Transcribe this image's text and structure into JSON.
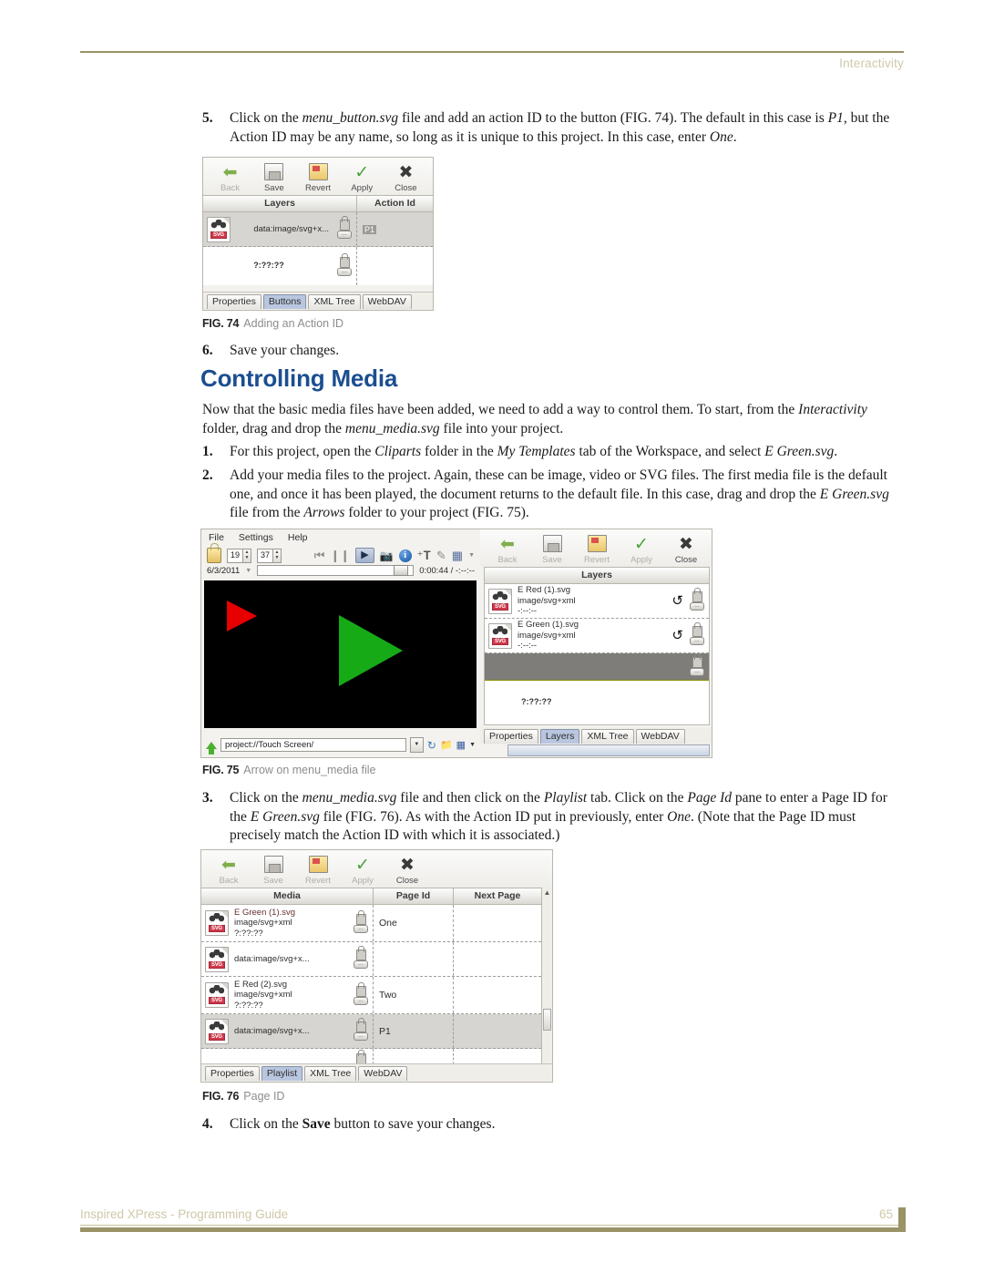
{
  "page": {
    "header_label": "Interactivity",
    "footer_title": "Inspired XPress - Programming Guide",
    "footer_page_number": "65",
    "accent_rule_color": "#9a9367",
    "heading_color": "#1b4e90"
  },
  "content": {
    "section_heading": "Controlling Media",
    "step5": {
      "number": "5.",
      "parts": [
        {
          "t": "Click on the ",
          "s": "n"
        },
        {
          "t": "menu_button.svg",
          "s": "i"
        },
        {
          "t": " file and add an action ID to the button (FIG. 74). The default in this case is ",
          "s": "n"
        },
        {
          "t": "P1",
          "s": "i"
        },
        {
          "t": ", but the Action ID may be any name, so long as it is unique to this project. In this case, enter ",
          "s": "n"
        },
        {
          "t": "One",
          "s": "i"
        },
        {
          "t": ".",
          "s": "n"
        }
      ]
    },
    "step6": {
      "number": "6.",
      "text": "Save your changes."
    },
    "intro_paragraph": [
      {
        "t": "Now that the basic media files have been added, we need to add a way to control them. To start, from the ",
        "s": "n"
      },
      {
        "t": "Interactivity",
        "s": "i"
      },
      {
        "t": " folder, drag and drop the ",
        "s": "n"
      },
      {
        "t": "menu_media.svg",
        "s": "i"
      },
      {
        "t": " file into your project.",
        "s": "n"
      }
    ],
    "step1": {
      "number": "1.",
      "parts": [
        {
          "t": "For this project, open the ",
          "s": "n"
        },
        {
          "t": "Cliparts",
          "s": "i"
        },
        {
          "t": " folder in the ",
          "s": "n"
        },
        {
          "t": "My Templates",
          "s": "i"
        },
        {
          "t": " tab of the Workspace, and select ",
          "s": "n"
        },
        {
          "t": "E Green.svg",
          "s": "i"
        },
        {
          "t": ".",
          "s": "n"
        }
      ]
    },
    "step2": {
      "number": "2.",
      "parts": [
        {
          "t": "Add your media files to the project. Again, these can be image, video or SVG files. The first media file is the default one, and once it has been played, the document returns to the default file. In this case, drag and drop the ",
          "s": "n"
        },
        {
          "t": "E Green.svg",
          "s": "i"
        },
        {
          "t": " file from the ",
          "s": "n"
        },
        {
          "t": "Arrows",
          "s": "i"
        },
        {
          "t": " folder to your project (FIG. 75).",
          "s": "n"
        }
      ]
    },
    "step3": {
      "number": "3.",
      "parts": [
        {
          "t": "Click on the ",
          "s": "n"
        },
        {
          "t": "menu_media.svg",
          "s": "i"
        },
        {
          "t": " file and then click on the ",
          "s": "n"
        },
        {
          "t": "Playlist",
          "s": "i"
        },
        {
          "t": " tab. Click on the ",
          "s": "n"
        },
        {
          "t": "Page Id",
          "s": "i"
        },
        {
          "t": " pane to enter a Page ID for the ",
          "s": "n"
        },
        {
          "t": "E Green.svg",
          "s": "i"
        },
        {
          "t": " file (FIG. 76). As with the Action ID put in previously, enter ",
          "s": "n"
        },
        {
          "t": "One",
          "s": "i"
        },
        {
          "t": ". (Note that the Page ID must precisely match the Action ID with which it is associated.)",
          "s": "n"
        }
      ]
    },
    "step4": {
      "number": "4.",
      "parts": [
        {
          "t": "Click on the ",
          "s": "n"
        },
        {
          "t": "Save",
          "s": "b"
        },
        {
          "t": " button to save your changes.",
          "s": "n"
        }
      ]
    }
  },
  "figures": {
    "fig74": {
      "caption_label": "FIG. 74",
      "caption_text": "Adding an Action ID",
      "toolbar": [
        {
          "label": "Back",
          "icon": "back-arrow-icon",
          "enabled": false
        },
        {
          "label": "Save",
          "icon": "save-disk-icon",
          "enabled": true
        },
        {
          "label": "Revert",
          "icon": "revert-icon",
          "enabled": true
        },
        {
          "label": "Apply",
          "icon": "checkmark-icon",
          "enabled": true
        },
        {
          "label": "Close",
          "icon": "close-x-icon",
          "enabled": true
        }
      ],
      "columns": [
        "Layers",
        "Action Id"
      ],
      "rows": [
        {
          "media": "data:image/svg+x...",
          "action_id": "P1",
          "selected": true
        },
        {
          "media": "",
          "action_id": "",
          "selected": false
        }
      ],
      "duration_text": "?:??:??",
      "tabs": [
        {
          "label": "Properties",
          "active": false
        },
        {
          "label": "Buttons",
          "active": true
        },
        {
          "label": "XML Tree",
          "active": false
        },
        {
          "label": "WebDAV",
          "active": false
        }
      ]
    },
    "fig75": {
      "caption_label": "FIG. 75",
      "caption_text": "Arrow on menu_media file",
      "menus": [
        "File",
        "Settings",
        "Help"
      ],
      "spinner_1": "19",
      "spinner_2": "37",
      "date_value": "6/3/2011",
      "time_readout": "0:00:44 / -:--:--",
      "transport_icons": [
        "skip-previous-icon",
        "pause-icon",
        "play-icon",
        "camera-icon",
        "info-icon",
        "add-text-icon",
        "edit-icon",
        "grid-icon",
        "chevron-down-icon"
      ],
      "path_value": "project://Touch Screen/",
      "path_icons": [
        "up-arrow-icon",
        "refresh-icon",
        "new-folder-icon",
        "view-grid-icon",
        "chevron-down-icon"
      ],
      "panel_toolbar": [
        {
          "label": "Back",
          "icon": "back-arrow-icon",
          "enabled": true
        },
        {
          "label": "Save",
          "icon": "save-disk-icon",
          "enabled": false
        },
        {
          "label": "Revert",
          "icon": "revert-icon",
          "enabled": false
        },
        {
          "label": "Apply",
          "icon": "checkmark-icon",
          "enabled": false
        },
        {
          "label": "Close",
          "icon": "close-x-icon",
          "enabled": true
        }
      ],
      "columns": [
        "Layers"
      ],
      "rows": [
        {
          "name": "E Red (1).svg",
          "mime": "image/svg+xml",
          "duration": "-:--:--",
          "loop": true
        },
        {
          "name": "E Green (1).svg",
          "mime": "image/svg+xml",
          "duration": "-:--:--",
          "loop": true
        }
      ],
      "duration_text": "?:??:??",
      "tabs": [
        {
          "label": "Properties",
          "active": false
        },
        {
          "label": "Layers",
          "active": true
        },
        {
          "label": "XML Tree",
          "active": false
        },
        {
          "label": "WebDAV",
          "active": false
        }
      ],
      "video": {
        "background": "#000000",
        "shapes": [
          {
            "name": "red-arrow-triangle",
            "color": "#e60000",
            "size": "small"
          },
          {
            "name": "green-arrow-triangle",
            "color": "#17aa17",
            "size": "large"
          }
        ]
      }
    },
    "fig76": {
      "caption_label": "FIG. 76",
      "caption_text": "Page ID",
      "toolbar": [
        {
          "label": "Back",
          "icon": "back-arrow-icon",
          "enabled": true
        },
        {
          "label": "Save",
          "icon": "save-disk-icon",
          "enabled": false
        },
        {
          "label": "Revert",
          "icon": "revert-icon",
          "enabled": false
        },
        {
          "label": "Apply",
          "icon": "checkmark-icon",
          "enabled": false
        },
        {
          "label": "Close",
          "icon": "close-x-icon",
          "enabled": true
        }
      ],
      "columns": [
        "Media",
        "Page Id",
        "Next Page"
      ],
      "rows": [
        {
          "name": "E Green (1).svg",
          "mime": "image/svg+xml",
          "duration": "?:??:??",
          "page_id": "One",
          "next_page": "",
          "selected": false
        },
        {
          "name": "data:image/svg+x...",
          "mime": "",
          "duration": "",
          "page_id": "",
          "next_page": "",
          "selected": false
        },
        {
          "name": "E Red (2).svg",
          "mime": "image/svg+xml",
          "duration": "?:??:??",
          "page_id": "Two",
          "next_page": "",
          "selected": false
        },
        {
          "name": "data:image/svg+x...",
          "mime": "",
          "duration": "",
          "page_id": "P1",
          "next_page": "",
          "selected": true
        },
        {
          "name": "",
          "mime": "",
          "duration": "",
          "page_id": "",
          "next_page": "",
          "selected": false
        }
      ],
      "tabs": [
        {
          "label": "Properties",
          "active": false
        },
        {
          "label": "Playlist",
          "active": true
        },
        {
          "label": "XML Tree",
          "active": false
        },
        {
          "label": "WebDAV",
          "active": false
        }
      ]
    }
  }
}
